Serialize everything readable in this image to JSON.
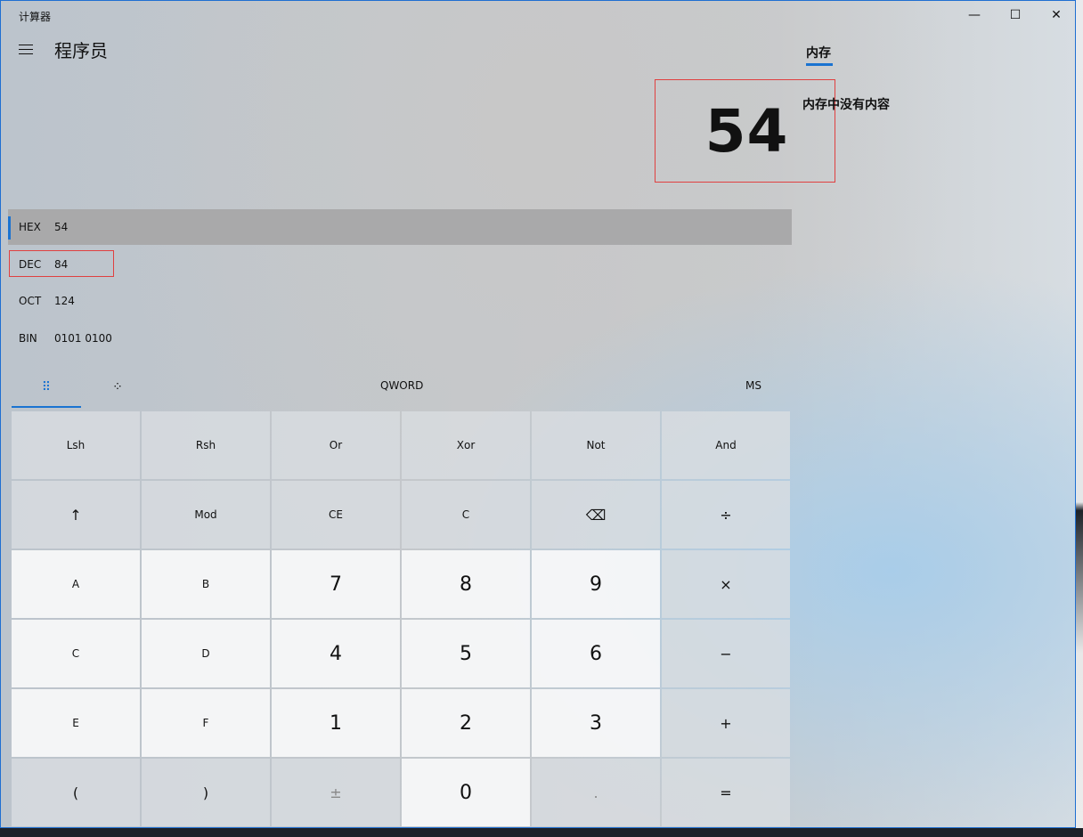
{
  "window": {
    "title": "计算器",
    "controls": {
      "minimize": "—",
      "maximize": "☐",
      "close": "✕"
    }
  },
  "header": {
    "mode_title": "程序员"
  },
  "display": {
    "value": "54"
  },
  "memory": {
    "tab_label": "内存",
    "empty_text": "内存中没有内容"
  },
  "radix": [
    {
      "name": "HEX",
      "value": "54"
    },
    {
      "name": "DEC",
      "value": "84"
    },
    {
      "name": "OCT",
      "value": "124"
    },
    {
      "name": "BIN",
      "value": "0101 0100"
    }
  ],
  "tabs": {
    "keypad_icon": "⠿",
    "bitflip_icon": "⁘",
    "word_size": "QWORD",
    "memory_store": "MS"
  },
  "keys": [
    [
      "Lsh",
      "Rsh",
      "Or",
      "Xor",
      "Not",
      "And"
    ],
    [
      "↑",
      "Mod",
      "CE",
      "C",
      "⌫",
      "÷"
    ],
    [
      "A",
      "B",
      "7",
      "8",
      "9",
      "×"
    ],
    [
      "C",
      "D",
      "4",
      "5",
      "6",
      "−"
    ],
    [
      "E",
      "F",
      "1",
      "2",
      "3",
      "+"
    ],
    [
      "(",
      ")",
      "±",
      "0",
      ".",
      "="
    ]
  ],
  "colors": {
    "accent": "#1a73d1",
    "highlight": "#e04040"
  }
}
